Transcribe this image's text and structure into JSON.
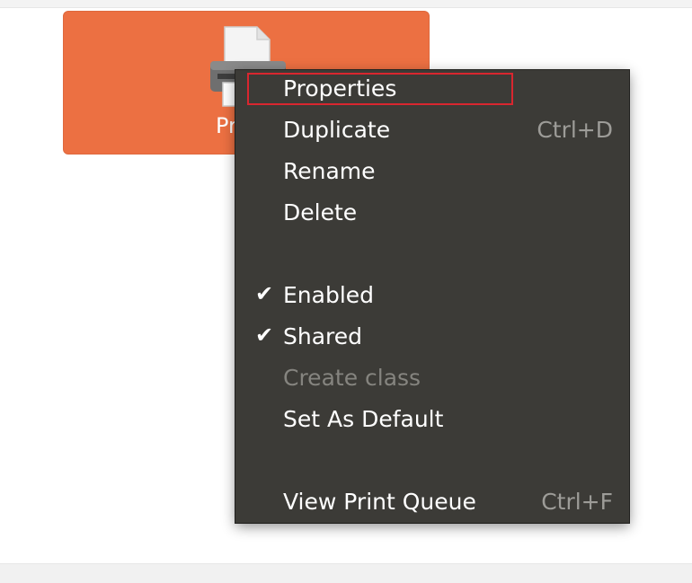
{
  "printer": {
    "name_partial": "Pr",
    "tile_color": "#ec7042",
    "icon": "printer-icon"
  },
  "menu": {
    "items": [
      {
        "label": "Properties",
        "accel": ""
      },
      {
        "label": "Duplicate",
        "accel": "Ctrl+D"
      },
      {
        "label": "Rename",
        "accel": ""
      },
      {
        "label": "Delete",
        "accel": ""
      },
      {
        "label": "Enabled",
        "checked": true,
        "check_glyph": "✔"
      },
      {
        "label": "Shared",
        "checked": true,
        "check_glyph": "✔"
      },
      {
        "label": "Create class",
        "disabled": true
      },
      {
        "label": "Set As Default"
      },
      {
        "label": "View Print Queue",
        "accel": "Ctrl+F"
      }
    ],
    "background": "#3c3b37",
    "highlight_color": "#d9262f"
  }
}
